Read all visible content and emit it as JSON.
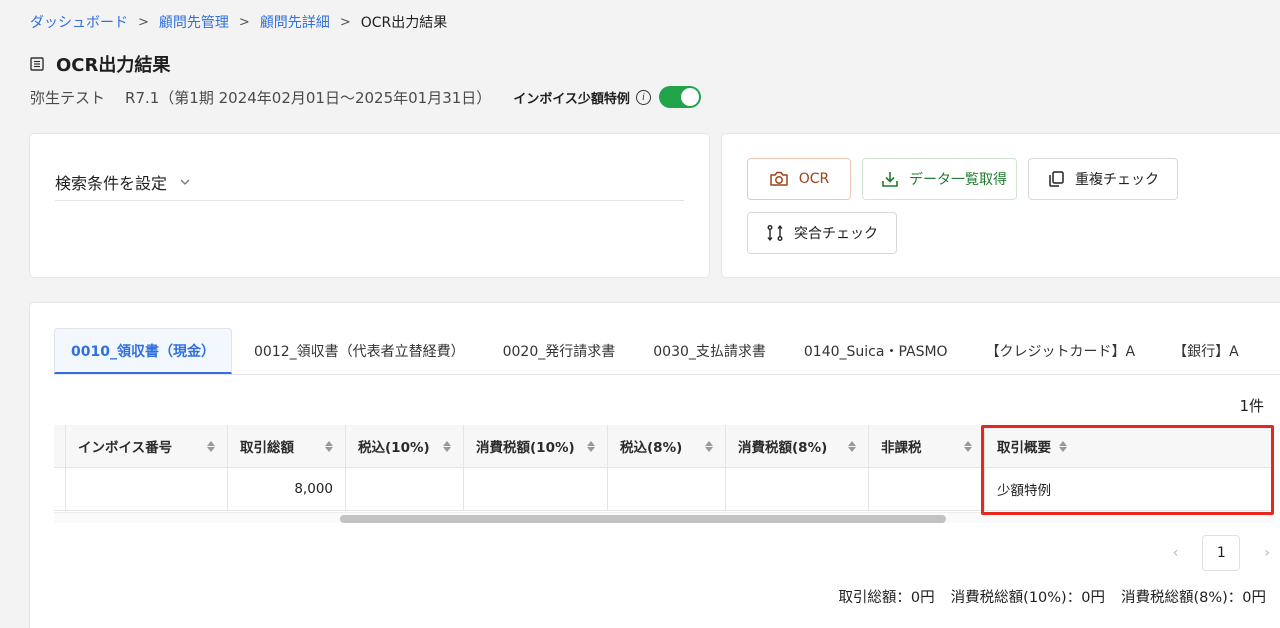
{
  "breadcrumb": {
    "items": [
      "ダッシュボード",
      "顧問先管理",
      "顧問先詳細"
    ],
    "current": "OCR出力結果",
    "separator": ">"
  },
  "page": {
    "title": "OCR出力結果",
    "client": "弥生テスト",
    "period": "R7.1（第1期 2024年02月01日〜2025年01月31日）",
    "invoice_label": "インボイス少額特例",
    "invoice_toggle_on": true,
    "info_glyph": "i"
  },
  "search": {
    "label": "検索条件を設定"
  },
  "actions": {
    "ocr": "OCR",
    "download": "データ一覧取得",
    "duplicate": "重複チェック",
    "match": "突合チェック"
  },
  "tabs": [
    "0010_領収書（現金）",
    "0012_領収書（代表者立替経費）",
    "0020_発行請求書",
    "0030_支払請求書",
    "0140_Suica・PASMO",
    "【クレジットカード】A",
    "【銀行】A"
  ],
  "active_tab": 0,
  "count": "1件",
  "table": {
    "headers": [
      "",
      "インボイス番号",
      "取引総額",
      "税込(10%)",
      "消費税額(10%)",
      "税込(8%)",
      "消費税額(8%)",
      "非課税",
      "取引概要"
    ],
    "rows": [
      [
        "",
        "",
        "8,000",
        "",
        "",
        "",
        "",
        "",
        "少額特例"
      ]
    ]
  },
  "pagination": {
    "current": "1",
    "prev": "‹",
    "next": "›"
  },
  "totals": {
    "total": "取引総額：0円",
    "tax10": "消費税総額(10%)：0円",
    "tax8": "消費税総額(8%)：0円"
  },
  "colors": {
    "link": "#2f6fde",
    "toggle": "#21a349",
    "highlight": "#e8281e"
  }
}
